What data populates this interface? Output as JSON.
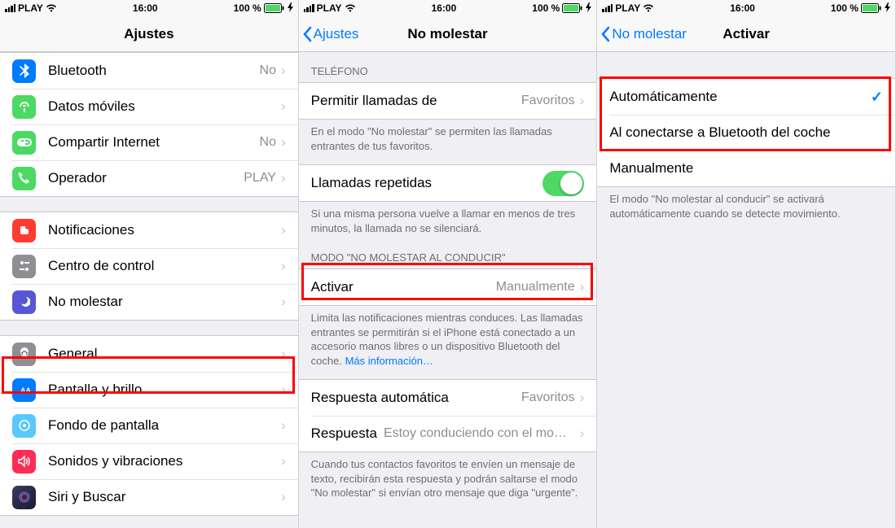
{
  "status": {
    "carrier": "PLAY",
    "time": "16:00",
    "battery": "100 %"
  },
  "screen1": {
    "title": "Ajustes",
    "rows": [
      {
        "id": "bluetooth",
        "label": "Bluetooth",
        "value": "No"
      },
      {
        "id": "mobile-data",
        "label": "Datos móviles",
        "value": ""
      },
      {
        "id": "hotspot",
        "label": "Compartir Internet",
        "value": "No"
      },
      {
        "id": "carrier",
        "label": "Operador",
        "value": "PLAY"
      },
      {
        "id": "notifications",
        "label": "Notificaciones",
        "value": ""
      },
      {
        "id": "control-center",
        "label": "Centro de control",
        "value": ""
      },
      {
        "id": "dnd",
        "label": "No molestar",
        "value": ""
      },
      {
        "id": "general",
        "label": "General",
        "value": ""
      },
      {
        "id": "display",
        "label": "Pantalla y brillo",
        "value": ""
      },
      {
        "id": "wallpaper",
        "label": "Fondo de pantalla",
        "value": ""
      },
      {
        "id": "sounds",
        "label": "Sonidos y vibraciones",
        "value": ""
      },
      {
        "id": "siri",
        "label": "Siri y Buscar",
        "value": ""
      }
    ]
  },
  "screen2": {
    "back": "Ajustes",
    "title": "No molestar",
    "header_phone": "TELÉFONO",
    "allow_calls_label": "Permitir llamadas de",
    "allow_calls_value": "Favoritos",
    "allow_calls_footer": "En el modo \"No molestar\" se permiten las llamadas entrantes de tus favoritos.",
    "repeat_label": "Llamadas repetidas",
    "repeat_footer": "Si una misma persona vuelve a llamar en menos de tres minutos, la llamada no se silenciará.",
    "header_drive": "MODO \"NO MOLESTAR AL CONDUCIR\"",
    "activate_label": "Activar",
    "activate_value": "Manualmente",
    "activate_footer": "Limita las notificaciones mientras conduces. Las llamadas entrantes se permitirán si el iPhone está conectado a un accesorio manos libres o un dispositivo Bluetooth del coche. ",
    "more_info": "Más información…",
    "auto_reply_to_label": "Respuesta automática",
    "auto_reply_to_value": "Favoritos",
    "auto_reply_label": "Respuesta",
    "auto_reply_value": "Estoy conduciendo con el mo…",
    "auto_reply_footer": "Cuando tus contactos favoritos te envíen un mensaje de texto, recibirán esta respuesta y podrán saltarse el modo \"No molestar\" si envían otro mensaje que diga \"urgente\"."
  },
  "screen3": {
    "back": "No molestar",
    "title": "Activar",
    "opt_auto": "Automáticamente",
    "opt_bt": "Al conectarse a Bluetooth del coche",
    "opt_manual": "Manualmente",
    "footer": "El modo \"No molestar al conducir\" se activará automáticamente cuando se detecte movimiento."
  }
}
